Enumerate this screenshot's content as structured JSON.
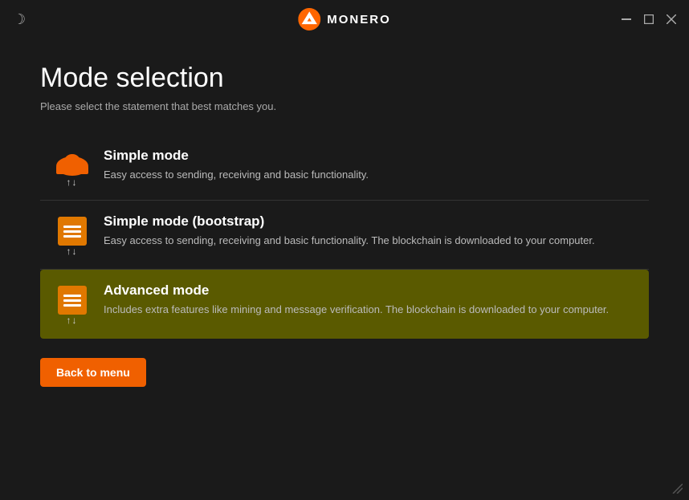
{
  "titlebar": {
    "title": "MONERO",
    "minimize_label": "minimize",
    "maximize_label": "maximize",
    "close_label": "close"
  },
  "page": {
    "title": "Mode selection",
    "subtitle": "Please select the statement that best matches you."
  },
  "modes": [
    {
      "id": "simple",
      "name": "Simple mode",
      "description": "Easy access to sending, receiving and basic functionality.",
      "icon_type": "cloud",
      "active": false
    },
    {
      "id": "bootstrap",
      "name": "Simple mode (bootstrap)",
      "description": "Easy access to sending, receiving and basic functionality. The blockchain is downloaded to your computer.",
      "icon_type": "server",
      "active": false
    },
    {
      "id": "advanced",
      "name": "Advanced mode",
      "description": "Includes extra features like mining and message verification. The blockchain is downloaded to your computer.",
      "icon_type": "server",
      "active": true
    }
  ],
  "back_button": {
    "label": "Back to menu"
  },
  "colors": {
    "accent": "#f06000",
    "active_bg": "#5a5a00"
  }
}
